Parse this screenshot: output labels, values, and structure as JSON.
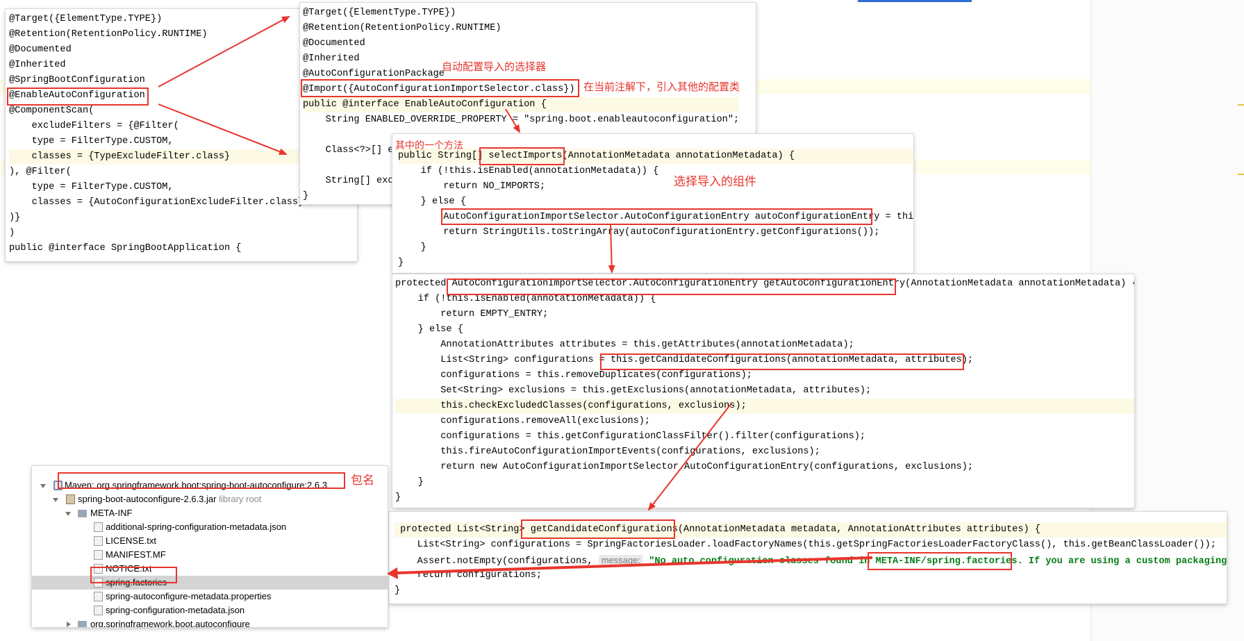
{
  "panel1": {
    "lines": [
      "@Target({ElementType.TYPE})",
      "@Retention(RetentionPolicy.RUNTIME)",
      "@Documented",
      "@Inherited",
      "@SpringBootConfiguration",
      "@EnableAutoConfiguration",
      "@ComponentScan(",
      "    excludeFilters = {@Filter(",
      "    type = FilterType.CUSTOM,",
      "    classes = {TypeExcludeFilter.class}",
      "), @Filter(",
      "    type = FilterType.CUSTOM,",
      "    classes = {AutoConfigurationExcludeFilter.class}",
      ")}",
      ")",
      "public @interface SpringBootApplication {",
      "    ..."
    ]
  },
  "panel2": {
    "lines": [
      "@Target({ElementType.TYPE})",
      "@Retention(RetentionPolicy.RUNTIME)",
      "@Documented",
      "@Inherited",
      "@AutoConfigurationPackage",
      "@Import({AutoConfigurationImportSelector.class})",
      "public @interface EnableAutoConfiguration {",
      "    String ENABLED_OVERRIDE_PROPERTY = \"spring.boot.enableautoconfiguration\";",
      "",
      "    Class<?>[] e",
      "",
      "    String[] exc",
      "}"
    ]
  },
  "panel3": {
    "lines": [
      "public String[] selectImports(AnnotationMetadata annotationMetadata) {",
      "    if (!this.isEnabled(annotationMetadata)) {",
      "        return NO_IMPORTS;",
      "    } else {",
      "        AutoConfigurationImportSelector.AutoConfigurationEntry autoConfigurationEntry = this.",
      "        return StringUtils.toStringArray(autoConfigurationEntry.getConfigurations());",
      "    }",
      "}"
    ]
  },
  "panel4": {
    "lines": [
      "protected AutoConfigurationImportSelector.AutoConfigurationEntry getAutoConfigurationEntry(AnnotationMetadata annotationMetadata) {",
      "    if (!this.isEnabled(annotationMetadata)) {",
      "        return EMPTY_ENTRY;",
      "    } else {",
      "        AnnotationAttributes attributes = this.getAttributes(annotationMetadata);",
      "        List<String> configurations = this.getCandidateConfigurations(annotationMetadata, attributes);",
      "        configurations = this.removeDuplicates(configurations);",
      "        Set<String> exclusions = this.getExclusions(annotationMetadata, attributes);",
      "        this.checkExcludedClasses(configurations, exclusions);",
      "        configurations.removeAll(exclusions);",
      "        configurations = this.getConfigurationClassFilter().filter(configurations);",
      "        this.fireAutoConfigurationImportEvents(configurations, exclusions);",
      "        return new AutoConfigurationImportSelector.AutoConfigurationEntry(configurations, exclusions);",
      "    }",
      "}"
    ]
  },
  "panel5": {
    "lines": [
      " protected List<String> getCandidateConfigurations(AnnotationMetadata metadata, AnnotationAttributes attributes) {",
      "    List<String> configurations = SpringFactoriesLoader.loadFactoryNames(this.getSpringFactoriesLoaderFactoryClass(), this.getBeanClassLoader());",
      "    Assert.notEmpty(configurations, ",
      "    return configurations;",
      "}"
    ],
    "hint_label": "message:",
    "message_text": "\"No auto configuration classes found in META-INF/spring.factories. If you are using a custom packaging,"
  },
  "tree": {
    "items": [
      {
        "label": "Maven: org.springframework.boot:spring-boot-autoconfigure:2.6.3",
        "extra": ""
      },
      {
        "label": "spring-boot-autoconfigure-2.6.3.jar",
        "extra": "library root"
      },
      {
        "label": "META-INF",
        "extra": ""
      },
      {
        "label": "additional-spring-configuration-metadata.json",
        "extra": ""
      },
      {
        "label": "LICENSE.txt",
        "extra": ""
      },
      {
        "label": "MANIFEST.MF",
        "extra": ""
      },
      {
        "label": "NOTICE.txt",
        "extra": ""
      },
      {
        "label": "spring.factories",
        "extra": ""
      },
      {
        "label": "spring-autoconfigure-metadata.properties",
        "extra": ""
      },
      {
        "label": "spring-configuration-metadata.json",
        "extra": ""
      },
      {
        "label": "org.springframework.boot.autoconfigure",
        "extra": ""
      }
    ]
  },
  "annotations": {
    "selector_note": "自动配置导入的选择器",
    "import_note": "在当前注解下，引入其他的配置类",
    "method_note": "其中的一个方法",
    "components_note": "选择导入的组件",
    "package_note": "包名"
  },
  "colors": {
    "annotation_red": "#e8352c",
    "keyword": "#000080",
    "string": "#067d17",
    "line_highlight": "#fcfae5",
    "selected_row": "#d4d4d4"
  }
}
